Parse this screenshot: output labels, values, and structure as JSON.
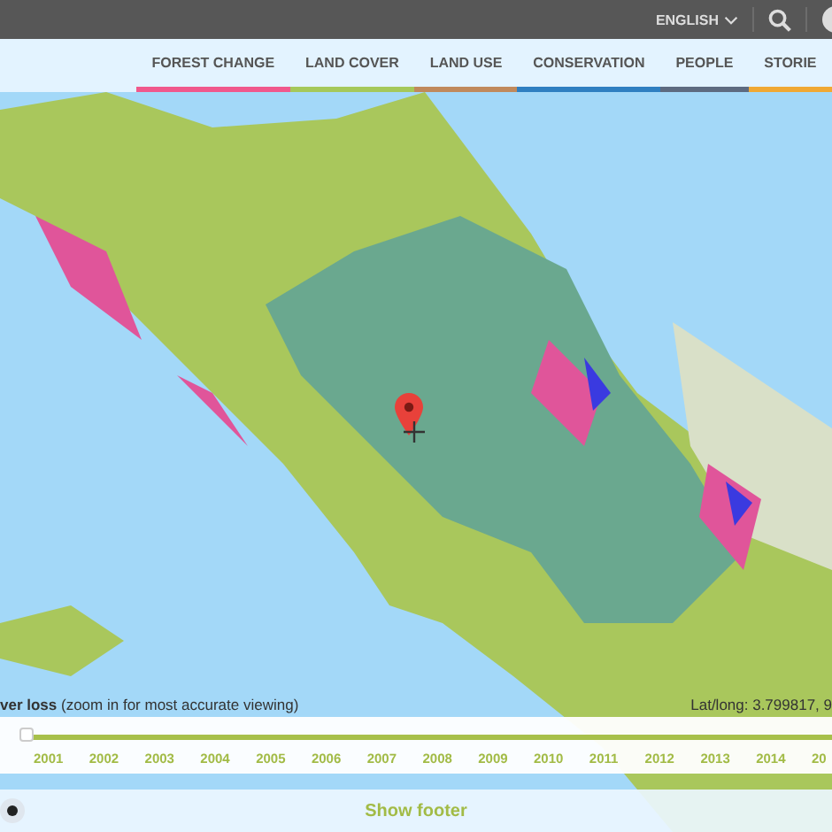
{
  "top_bar": {
    "language": "ENGLISH"
  },
  "tabs": [
    {
      "label": "FOREST CHANGE",
      "color": "#f0588c",
      "selected": false
    },
    {
      "label": "LAND COVER",
      "color": "#a5c85a",
      "selected": false
    },
    {
      "label": "LAND USE",
      "color": "#c0895c",
      "selected": false
    },
    {
      "label": "CONSERVATION",
      "color": "#2f7fc1",
      "selected": false
    },
    {
      "label": "PEOPLE",
      "color": "#5d6a80",
      "selected": false
    },
    {
      "label": "STORIE",
      "color": "#f0a834",
      "selected": false
    }
  ],
  "legend": {
    "text": "**ver loss** (zoom in for most accurate viewing)"
  },
  "coordinates": "Lat/long: 3.799817, 9",
  "timeline": {
    "level": 0,
    "years": [
      "2001",
      "2002",
      "2003",
      "2004",
      "2005",
      "2006",
      "2007",
      "2008",
      "2009",
      "2010",
      "2011",
      "2012",
      "2013",
      "2014",
      "20"
    ]
  },
  "footer": {
    "label": "Show footer"
  }
}
